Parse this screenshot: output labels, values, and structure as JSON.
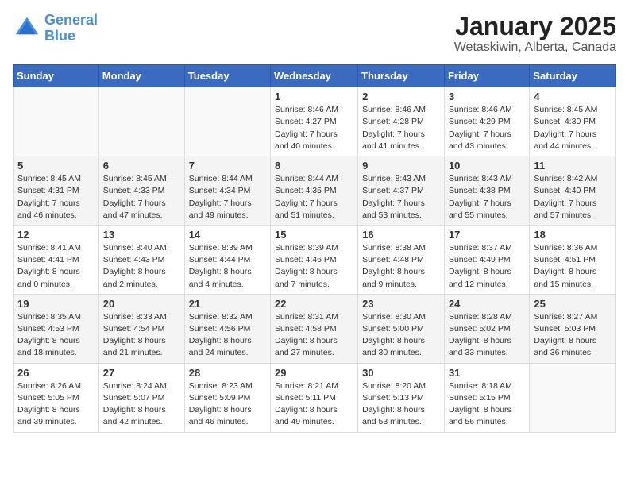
{
  "header": {
    "logo_line1": "General",
    "logo_line2": "Blue",
    "month": "January 2025",
    "location": "Wetaskiwin, Alberta, Canada"
  },
  "weekdays": [
    "Sunday",
    "Monday",
    "Tuesday",
    "Wednesday",
    "Thursday",
    "Friday",
    "Saturday"
  ],
  "weeks": [
    [
      {
        "day": "",
        "text": ""
      },
      {
        "day": "",
        "text": ""
      },
      {
        "day": "",
        "text": ""
      },
      {
        "day": "1",
        "text": "Sunrise: 8:46 AM\nSunset: 4:27 PM\nDaylight: 7 hours\nand 40 minutes."
      },
      {
        "day": "2",
        "text": "Sunrise: 8:46 AM\nSunset: 4:28 PM\nDaylight: 7 hours\nand 41 minutes."
      },
      {
        "day": "3",
        "text": "Sunrise: 8:46 AM\nSunset: 4:29 PM\nDaylight: 7 hours\nand 43 minutes."
      },
      {
        "day": "4",
        "text": "Sunrise: 8:45 AM\nSunset: 4:30 PM\nDaylight: 7 hours\nand 44 minutes."
      }
    ],
    [
      {
        "day": "5",
        "text": "Sunrise: 8:45 AM\nSunset: 4:31 PM\nDaylight: 7 hours\nand 46 minutes."
      },
      {
        "day": "6",
        "text": "Sunrise: 8:45 AM\nSunset: 4:33 PM\nDaylight: 7 hours\nand 47 minutes."
      },
      {
        "day": "7",
        "text": "Sunrise: 8:44 AM\nSunset: 4:34 PM\nDaylight: 7 hours\nand 49 minutes."
      },
      {
        "day": "8",
        "text": "Sunrise: 8:44 AM\nSunset: 4:35 PM\nDaylight: 7 hours\nand 51 minutes."
      },
      {
        "day": "9",
        "text": "Sunrise: 8:43 AM\nSunset: 4:37 PM\nDaylight: 7 hours\nand 53 minutes."
      },
      {
        "day": "10",
        "text": "Sunrise: 8:43 AM\nSunset: 4:38 PM\nDaylight: 7 hours\nand 55 minutes."
      },
      {
        "day": "11",
        "text": "Sunrise: 8:42 AM\nSunset: 4:40 PM\nDaylight: 7 hours\nand 57 minutes."
      }
    ],
    [
      {
        "day": "12",
        "text": "Sunrise: 8:41 AM\nSunset: 4:41 PM\nDaylight: 8 hours\nand 0 minutes."
      },
      {
        "day": "13",
        "text": "Sunrise: 8:40 AM\nSunset: 4:43 PM\nDaylight: 8 hours\nand 2 minutes."
      },
      {
        "day": "14",
        "text": "Sunrise: 8:39 AM\nSunset: 4:44 PM\nDaylight: 8 hours\nand 4 minutes."
      },
      {
        "day": "15",
        "text": "Sunrise: 8:39 AM\nSunset: 4:46 PM\nDaylight: 8 hours\nand 7 minutes."
      },
      {
        "day": "16",
        "text": "Sunrise: 8:38 AM\nSunset: 4:48 PM\nDaylight: 8 hours\nand 9 minutes."
      },
      {
        "day": "17",
        "text": "Sunrise: 8:37 AM\nSunset: 4:49 PM\nDaylight: 8 hours\nand 12 minutes."
      },
      {
        "day": "18",
        "text": "Sunrise: 8:36 AM\nSunset: 4:51 PM\nDaylight: 8 hours\nand 15 minutes."
      }
    ],
    [
      {
        "day": "19",
        "text": "Sunrise: 8:35 AM\nSunset: 4:53 PM\nDaylight: 8 hours\nand 18 minutes."
      },
      {
        "day": "20",
        "text": "Sunrise: 8:33 AM\nSunset: 4:54 PM\nDaylight: 8 hours\nand 21 minutes."
      },
      {
        "day": "21",
        "text": "Sunrise: 8:32 AM\nSunset: 4:56 PM\nDaylight: 8 hours\nand 24 minutes."
      },
      {
        "day": "22",
        "text": "Sunrise: 8:31 AM\nSunset: 4:58 PM\nDaylight: 8 hours\nand 27 minutes."
      },
      {
        "day": "23",
        "text": "Sunrise: 8:30 AM\nSunset: 5:00 PM\nDaylight: 8 hours\nand 30 minutes."
      },
      {
        "day": "24",
        "text": "Sunrise: 8:28 AM\nSunset: 5:02 PM\nDaylight: 8 hours\nand 33 minutes."
      },
      {
        "day": "25",
        "text": "Sunrise: 8:27 AM\nSunset: 5:03 PM\nDaylight: 8 hours\nand 36 minutes."
      }
    ],
    [
      {
        "day": "26",
        "text": "Sunrise: 8:26 AM\nSunset: 5:05 PM\nDaylight: 8 hours\nand 39 minutes."
      },
      {
        "day": "27",
        "text": "Sunrise: 8:24 AM\nSunset: 5:07 PM\nDaylight: 8 hours\nand 42 minutes."
      },
      {
        "day": "28",
        "text": "Sunrise: 8:23 AM\nSunset: 5:09 PM\nDaylight: 8 hours\nand 46 minutes."
      },
      {
        "day": "29",
        "text": "Sunrise: 8:21 AM\nSunset: 5:11 PM\nDaylight: 8 hours\nand 49 minutes."
      },
      {
        "day": "30",
        "text": "Sunrise: 8:20 AM\nSunset: 5:13 PM\nDaylight: 8 hours\nand 53 minutes."
      },
      {
        "day": "31",
        "text": "Sunrise: 8:18 AM\nSunset: 5:15 PM\nDaylight: 8 hours\nand 56 minutes."
      },
      {
        "day": "",
        "text": ""
      }
    ]
  ]
}
